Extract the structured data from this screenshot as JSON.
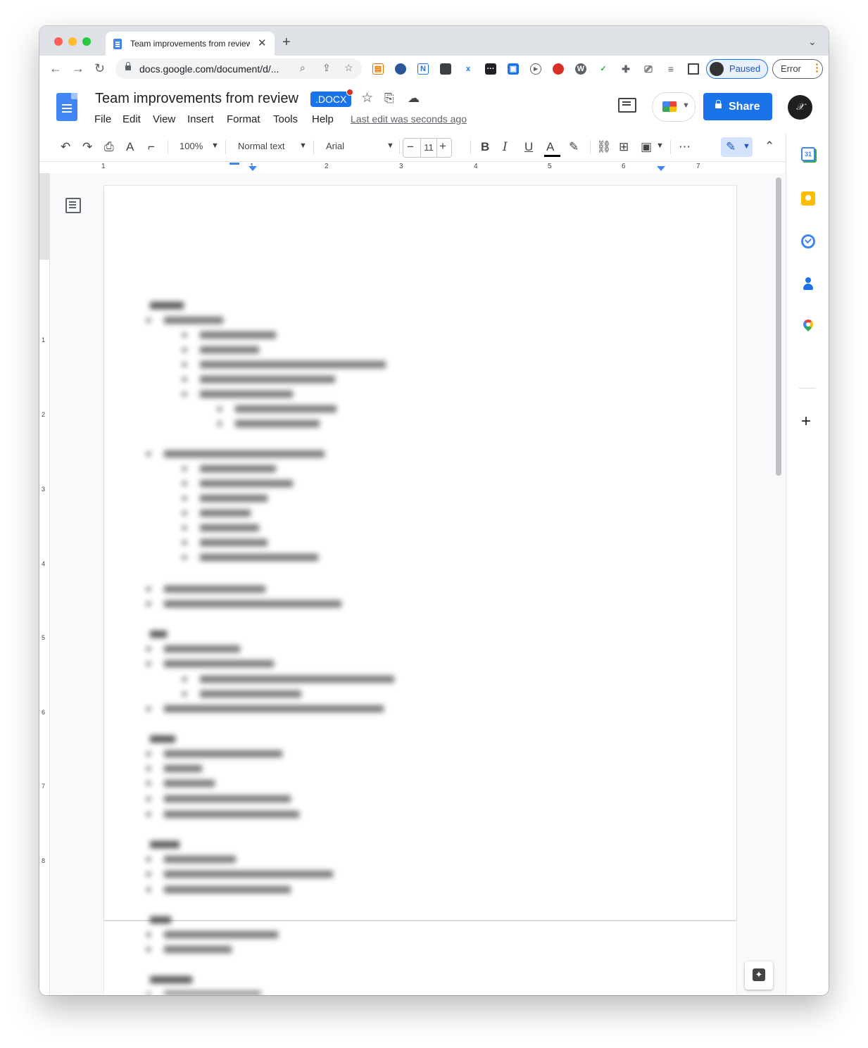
{
  "browser": {
    "tab_title": "Team improvements from review",
    "url": "docs.google.com/document/d/...",
    "profile_label": "Paused",
    "error_label": "Error"
  },
  "docs": {
    "title": "Team improvements from review",
    "badge": ".DOCX",
    "last_edit": "Last edit was seconds ago",
    "share_label": "Share",
    "menu": [
      "File",
      "Edit",
      "View",
      "Insert",
      "Format",
      "Tools",
      "Help"
    ]
  },
  "toolbar": {
    "zoom": "100%",
    "style": "Normal text",
    "font": "Arial",
    "font_size": "11"
  },
  "ruler": {
    "h_numbers": [
      "1",
      "1",
      "2",
      "3",
      "4",
      "5",
      "6",
      "7"
    ],
    "v_numbers": [
      "1",
      "2",
      "3",
      "4",
      "5",
      "6",
      "7",
      "8"
    ]
  },
  "sidepanel": {
    "calendar_day": "31"
  },
  "icons": {
    "colors": {
      "accent": "#1a73e8",
      "docs_blue": "#4285f4",
      "keep_yellow": "#fbbc04",
      "error_orange": "#e37400"
    }
  }
}
